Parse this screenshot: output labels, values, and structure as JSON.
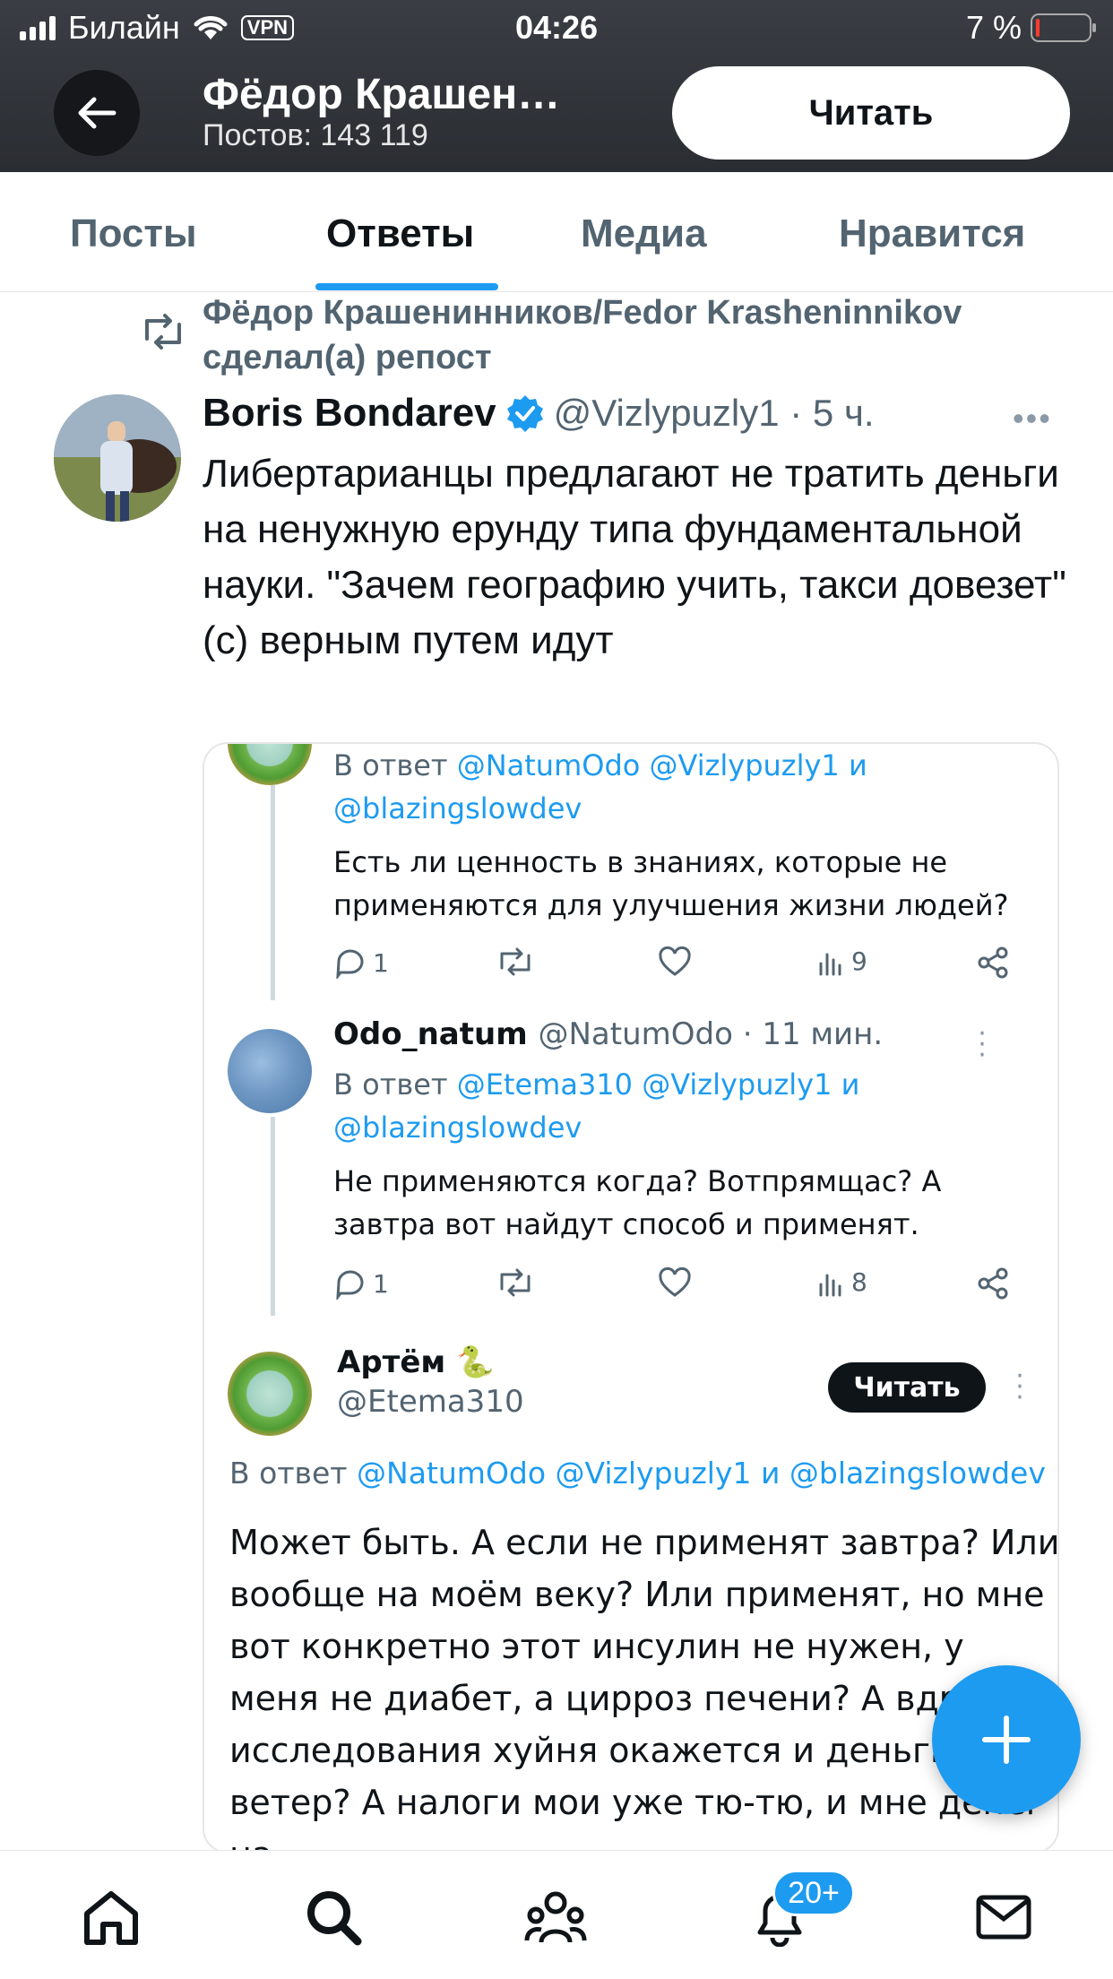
{
  "status_bar": {
    "carrier": "Билайн",
    "vpn": "VPN",
    "time": "04:26",
    "battery": "7 %",
    "battery_level": 0.07
  },
  "header": {
    "profile_name": "Фёдор Крашен…",
    "posts_count": "Постов: 143 119",
    "follow_label": "Читать"
  },
  "tabs": [
    {
      "label": "Посты"
    },
    {
      "label": "Ответы"
    },
    {
      "label": "Медиа"
    },
    {
      "label": "Нравится"
    }
  ],
  "post": {
    "repost_text": "Фёдор Крашенинников/Fedor Krasheninnikov сделал(а) репост",
    "author": "Boris Bondarev",
    "handle_time": "@Vizlypuzly1 · 5 ч.",
    "text": "Либертарианцы предлагают не тратить деньги на ненужную ерунду типа фундаментальной науки. \"Зачем географию учить, такси довезет\" (с) верным путем идут"
  },
  "card": {
    "reply1": {
      "in_reply_prefix": "В ответ",
      "mentions_line1": "@NatumOdo @Vizlypuzly1 и",
      "mentions_line2": "@blazingslowdev",
      "text": "Есть ли ценность в знаниях, которые не применяются для улучшения жизни людей?",
      "replies": "1",
      "views": "9"
    },
    "reply2": {
      "name": "Odo_natum",
      "handle_time": "@NatumOdo · 11 мин.",
      "in_reply_prefix": "В ответ",
      "mentions_line1": "@Etema310 @Vizlypuzly1 и",
      "mentions_line2": "@blazingslowdev",
      "text": "Не применяются когда? Вотпрямщас? А завтра вот найдут способ и применят.",
      "replies": "1",
      "views": "8"
    },
    "reply3": {
      "name": "Артём 🐍",
      "handle": "@Etema310",
      "follow_label": "Читать",
      "in_reply_prefix": "В ответ",
      "mentions": "@NatumOdo @Vizlypuzly1 и @blazingslowdev",
      "text": "Может быть. А если не применят завтра? Или вообще на моём веку? Или применят, но мне вот конкретно этот инсулин не нужен, у меня не диабет, а цирроз печени? А вдруг исследования хуйня окажется и деньги на ветер? А налоги мои уже тю-тю, и мне денег на"
    }
  },
  "bottom_nav": {
    "items": [
      "home-icon",
      "search-icon",
      "communities-icon",
      "notifications-icon",
      "messages-icon"
    ],
    "notifications_badge": "20+"
  },
  "colors": {
    "accent": "#1d9bf0",
    "header_bg": "#2e3136",
    "text_primary": "#0f1419",
    "text_secondary": "#536471"
  }
}
